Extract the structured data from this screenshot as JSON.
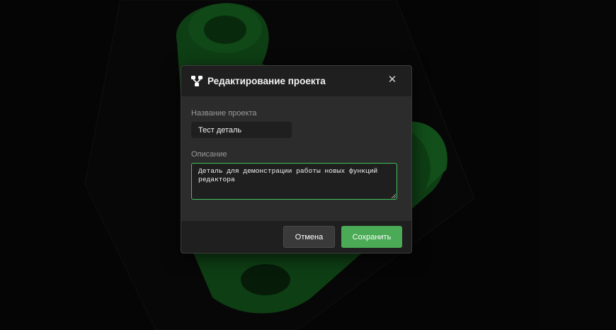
{
  "dialog": {
    "title": "Редактирование проекта",
    "icon": "project-share-icon",
    "close_symbol": "✕",
    "close_icon": "close-icon"
  },
  "form": {
    "name_label": "Название проекта",
    "name_value": "Тест деталь",
    "description_label": "Описание",
    "description_value": "Деталь для демонстрации работы новых функций редактора"
  },
  "footer": {
    "cancel_label": "Отмена",
    "save_label": "Сохранить"
  },
  "colors": {
    "accent": "#4aaa55",
    "focus_border": "#3fbf5c",
    "model": "#1f8a2e",
    "panel": "#2c2c2c",
    "header": "#1f1f1f"
  }
}
